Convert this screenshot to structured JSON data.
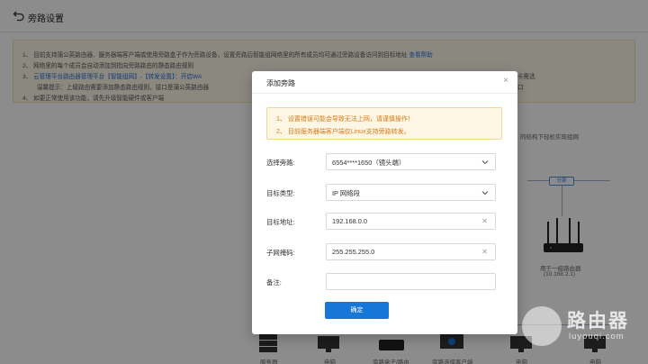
{
  "header": {
    "title": "旁路设置"
  },
  "notice": {
    "lines": [
      {
        "num": "1、",
        "text": "目前支持蒲公英路由器、服务器端客户端或使用旁路盒子作为旁路设备，设置旁路后智能组网络里的所有成员均可通过旁路设备访问到目标地址",
        "link": "查看帮助"
      },
      {
        "num": "2、",
        "text": "网络里的每个成员会自动添加到指向旁路路由的静态路由规则"
      },
      {
        "num": "3、",
        "accent": "云管理平台路由器管理平台【智能组网】-【转发设置】：开启WA",
        "tail": "虚拟网卡需选",
        "tail_right": "口"
      },
      {
        "num": "",
        "text": "温馨提示：上级路由需要添加静态路由规则，接口是蒲公英路由器"
      },
      {
        "num": "4、",
        "text": "如要正常使用该功能，请先升级智能硬件或客户端"
      }
    ]
  },
  "diagram": {
    "right_text_1": "的结构下轻松实现组网",
    "cloud_tag": "分部",
    "router_caption_1": "用于一级路由器",
    "router_caption_2": "(10.168.2.1)",
    "bottom_labels": [
      "服务器",
      "电脑",
      "旁路盒子/路由",
      "旁路选择客户端",
      "电脑",
      "电脑"
    ]
  },
  "modal": {
    "title": "添加旁路",
    "close_label": "×",
    "warnings": [
      "1、  设置错误可能会导致无法上网，请谨慎操作！",
      "2、  目前服务器端客户端仅Linux支持旁路转发。"
    ],
    "fields": {
      "bypass": {
        "label": "选择旁路:",
        "value": "6554****1650（镜头端）"
      },
      "target_type": {
        "label": "目标类型:",
        "value": "IP 网络段"
      },
      "target_addr": {
        "label": "目标地址:",
        "value": "192.168.0.0"
      },
      "subnet": {
        "label": "子网掩码:",
        "value": "255.255.255.0"
      },
      "remark": {
        "label": "备注:",
        "value": ""
      }
    },
    "confirm_label": "确定"
  },
  "watermark": {
    "cn": "路由器",
    "en": "luyouqi.com"
  }
}
